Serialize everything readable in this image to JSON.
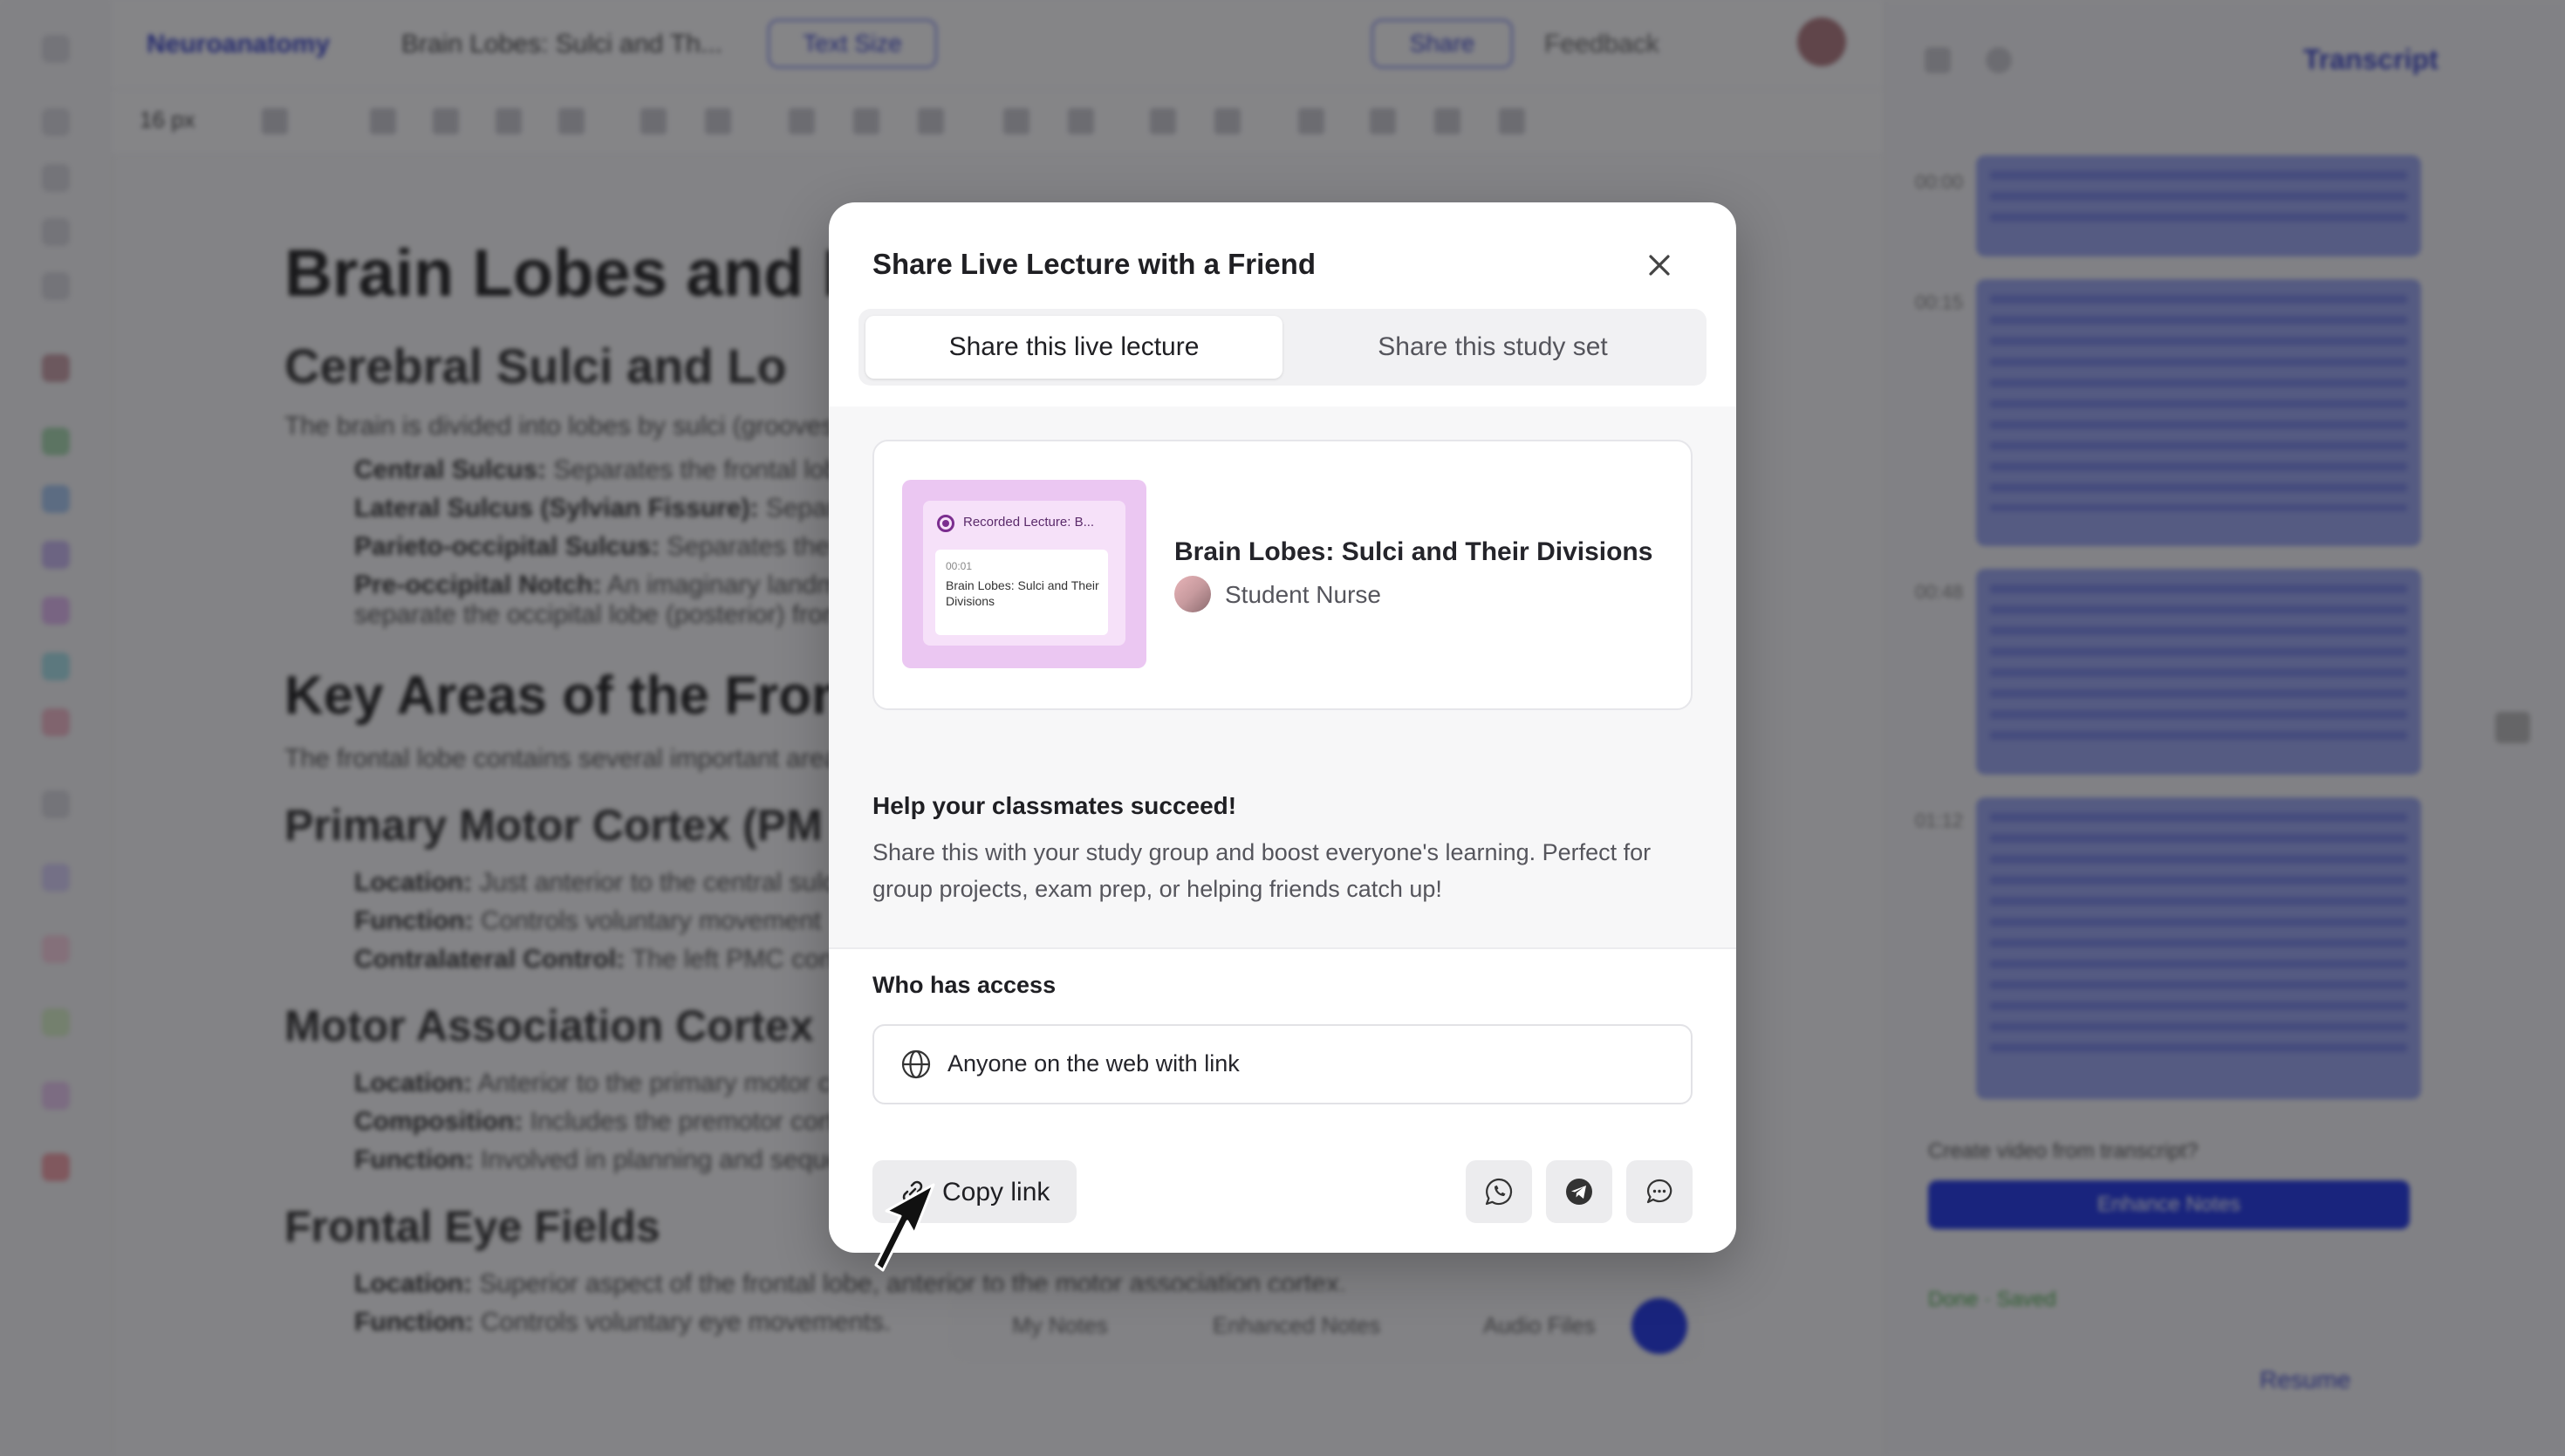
{
  "background": {
    "breadcrumb_root": "Neuroanatomy",
    "breadcrumb_current": "Brain Lobes: Sulci and Th...",
    "text_size_pill": "Text Size",
    "share_pill": "Share",
    "feedback": "Feedback",
    "font_size": "16 px",
    "transcript_tab": "Transcript",
    "doc_h1": "Brain Lobes and K",
    "doc_h2a": "Cerebral Sulci and Lo",
    "doc_para1": "The brain is divided into lobes by sulci (grooves)",
    "doc_li1_b": "Central Sulcus:",
    "doc_li1": " Separates the frontal lobe",
    "doc_li2_b": "Lateral Sulcus (Sylvian Fissure):",
    "doc_li2": " Separates",
    "doc_li3_b": "Parieto-occipital Sulcus:",
    "doc_li3": " Separates the pa",
    "doc_li4_b": "Pre-occipital Notch:",
    "doc_li4": " An imaginary landmark",
    "doc_li4b": "separate the occipital lobe (posterior) from",
    "doc_h1b": "Key Areas of the Fron",
    "doc_para2": "The frontal lobe contains several important area",
    "doc_h2b": "Primary Motor Cortex (PM",
    "doc_li5_b": "Location:",
    "doc_li5": " Just anterior to the central sulcu",
    "doc_li6_b": "Function:",
    "doc_li6": " Controls voluntary movement",
    "doc_li7_b": "Contralateral Control:",
    "doc_li7": " The left PMC control",
    "doc_h2c": "Motor Association Cortex",
    "doc_li8_b": "Location:",
    "doc_li8": " Anterior to the primary motor c",
    "doc_li9_b": "Composition:",
    "doc_li9": " Includes the premotor cort",
    "doc_li10_b": "Function:",
    "doc_li10": " Involved in planning and sequencing movements",
    "doc_h2d": "Frontal Eye Fields",
    "doc_li11_b": "Location:",
    "doc_li11": " Superior aspect of the frontal lobe, anterior to the motor association cortex.",
    "doc_li12_b": "Function:",
    "doc_li12": " Controls voluntary eye movements.",
    "bottom_bar": [
      "My Notes",
      "Enhanced Notes",
      "Audio Files"
    ],
    "create_video_prompt": "Create video from transcript?",
    "create_video_button": "Enhance Notes",
    "status_text": "Done · Saved",
    "resume_button": "Resume"
  },
  "modal": {
    "title": "Share Live Lecture with a Friend",
    "tabs": [
      {
        "label": "Share this live lecture",
        "active": true
      },
      {
        "label": "Share this study set",
        "active": false
      }
    ],
    "preview": {
      "recorded_label": "Recorded Lecture: B...",
      "mini_time": "00:01",
      "mini_title": "Brain Lobes: Sulci and Their Divisions",
      "lecture_title": "Brain Lobes: Sulci and Their Divisions",
      "author": "Student Nurse"
    },
    "help_heading": "Help your classmates succeed!",
    "help_text": "Share this with your study group and boost everyone's learning. Perfect for group projects, exam prep, or helping friends catch up!",
    "access_heading": "Who has access",
    "access_value": "Anyone on the web with link",
    "copy_link_label": "Copy link",
    "share_icons": [
      "whatsapp-icon",
      "telegram-icon",
      "message-icon"
    ],
    "colors": {
      "thumb_bg": "#ebc7f2",
      "accent": "#3b46c9"
    }
  }
}
